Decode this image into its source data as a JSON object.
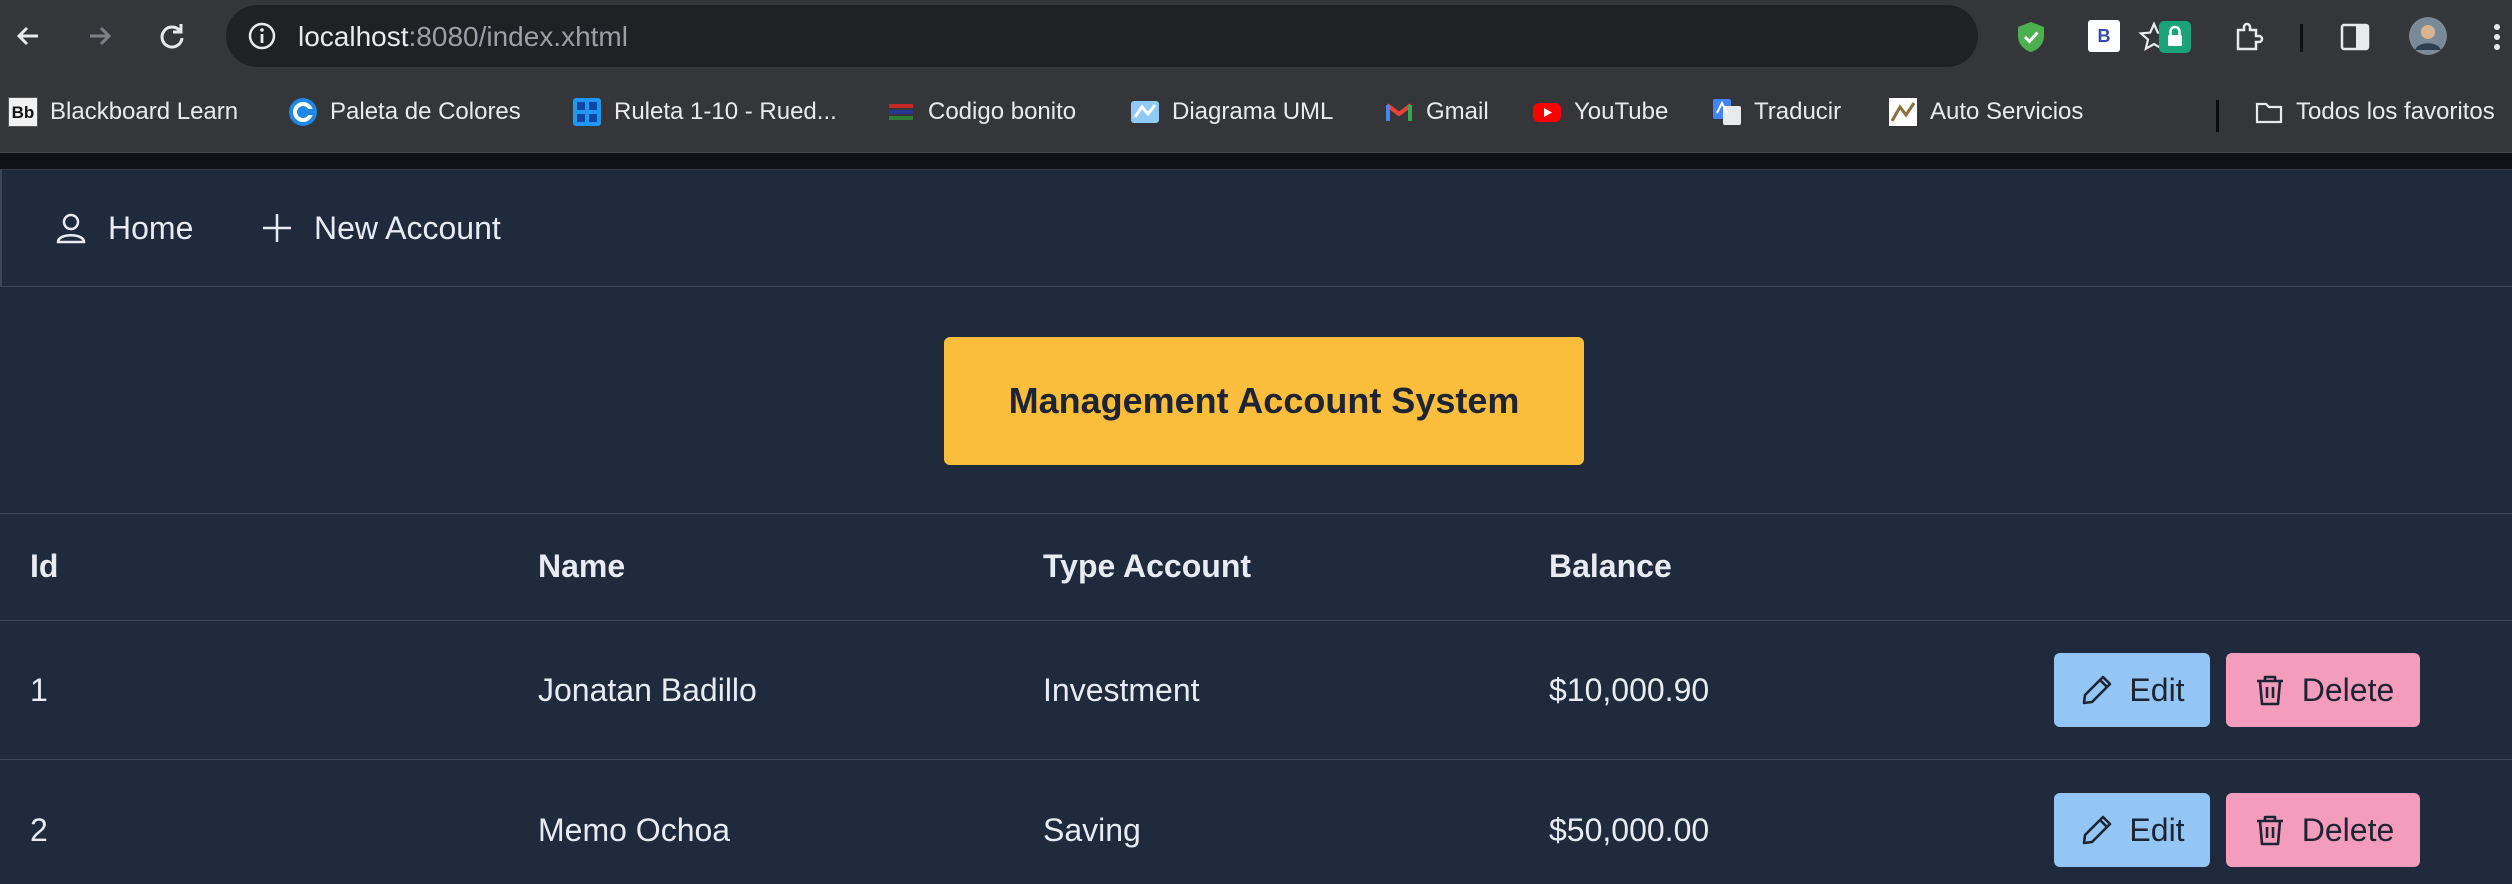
{
  "browser": {
    "url_host": "localhost",
    "url_path": ":8080/index.xhtml",
    "bookmarks": [
      {
        "label": "Blackboard Learn",
        "icon": "blackboard-icon"
      },
      {
        "label": "Paleta de Colores",
        "icon": "palette-icon"
      },
      {
        "label": "Ruleta 1-10 - Rued...",
        "icon": "wheel-icon"
      },
      {
        "label": "Codigo bonito",
        "icon": "code-icon"
      },
      {
        "label": "Diagrama UML",
        "icon": "uml-icon"
      },
      {
        "label": "Gmail",
        "icon": "gmail-icon"
      },
      {
        "label": "YouTube",
        "icon": "youtube-icon"
      },
      {
        "label": "Traducir",
        "icon": "translate-icon"
      },
      {
        "label": "Auto Servicios",
        "icon": "auto-icon"
      }
    ],
    "all_bookmarks_label": "Todos los favoritos",
    "blackboard_badge": "Bb",
    "ext_b_badge": "B"
  },
  "menu": {
    "home_label": "Home",
    "new_account_label": "New Account"
  },
  "header": {
    "title": "Management Account System"
  },
  "table": {
    "columns": [
      "Id",
      "Name",
      "Type Account",
      "Balance"
    ],
    "rows": [
      {
        "id": "1",
        "name": "Jonatan Badillo",
        "type": "Investment",
        "balance": "$10,000.90"
      },
      {
        "id": "2",
        "name": "Memo Ochoa",
        "type": "Saving",
        "balance": "$50,000.00"
      }
    ],
    "edit_label": "Edit",
    "delete_label": "Delete"
  },
  "colors": {
    "background": "#1f2a3c",
    "header_button": "#fbbd3c",
    "edit_button": "#93c5f5",
    "delete_button": "#f49cbb"
  }
}
